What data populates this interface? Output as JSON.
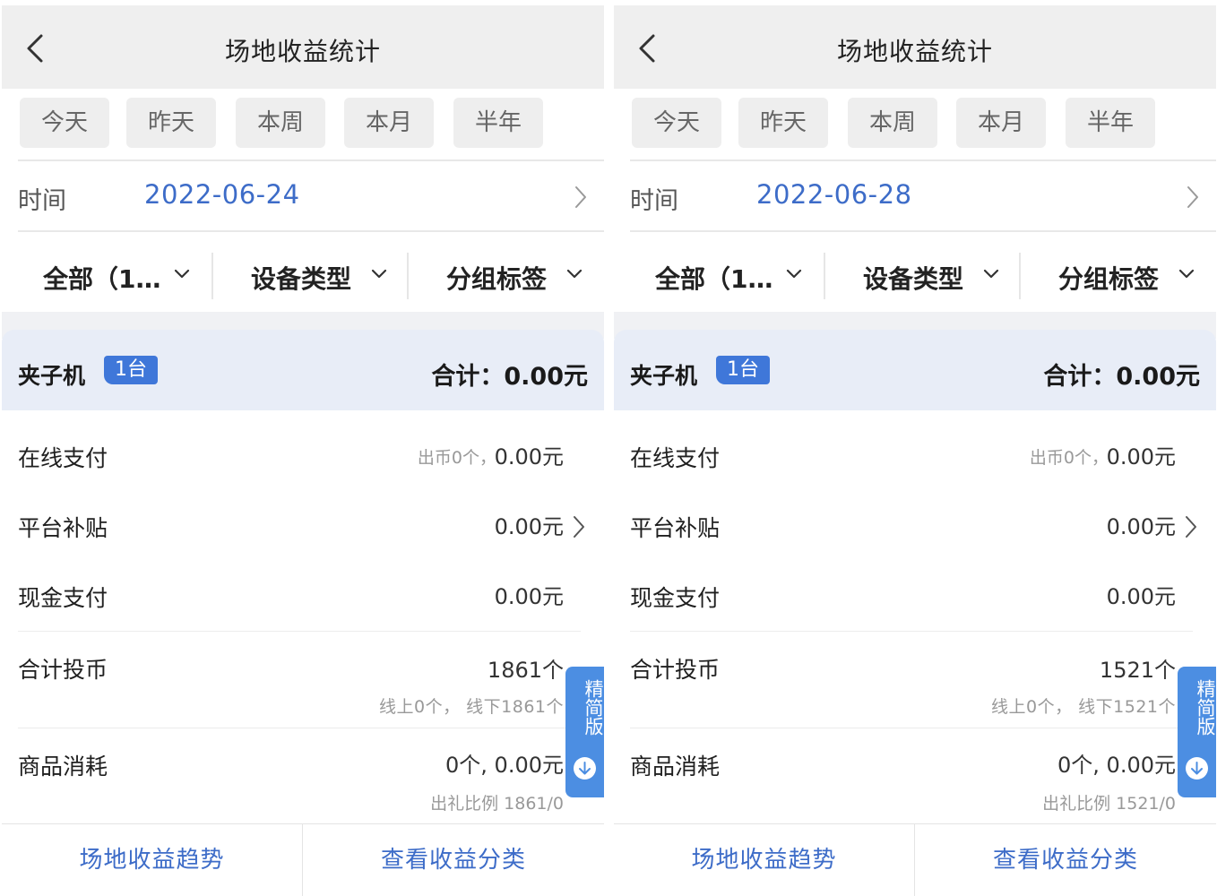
{
  "screens": [
    {
      "header": {
        "title": "场地收益统计",
        "back_icon": "chevron-left-icon"
      },
      "period_tabs": [
        "今天",
        "昨天",
        "本周",
        "本月",
        "半年"
      ],
      "time": {
        "label": "时间",
        "value": "2022-06-24"
      },
      "filters": [
        "全部（1…",
        "设备类型",
        "分组标签"
      ],
      "category": {
        "name": "夹子机",
        "count_badge": "1台",
        "total": "合计：0.00元"
      },
      "rows": {
        "online": {
          "label": "在线支付",
          "note": "出币0个，",
          "value": "0.00元"
        },
        "subsidy": {
          "label": "平台补贴",
          "value": "0.00元"
        },
        "cash": {
          "label": "现金支付",
          "value": "0.00元"
        },
        "coins": {
          "label": "合计投币",
          "value": "1861个",
          "sub": "线上0个， 线下1861个"
        },
        "goods": {
          "label": "商品消耗",
          "value": "0个, 0.00元",
          "sub": "出礼比例 1861/0"
        }
      },
      "side_button": {
        "label": "精简版",
        "icon": "arrow-down-circle-icon"
      },
      "bottom_buttons": [
        "场地收益趋势",
        "查看收益分类"
      ]
    },
    {
      "header": {
        "title": "场地收益统计",
        "back_icon": "chevron-left-icon"
      },
      "period_tabs": [
        "今天",
        "昨天",
        "本周",
        "本月",
        "半年"
      ],
      "time": {
        "label": "时间",
        "value": "2022-06-28"
      },
      "filters": [
        "全部（1…",
        "设备类型",
        "分组标签"
      ],
      "category": {
        "name": "夹子机",
        "count_badge": "1台",
        "total": "合计：0.00元"
      },
      "rows": {
        "online": {
          "label": "在线支付",
          "note": "出币0个，",
          "value": "0.00元"
        },
        "subsidy": {
          "label": "平台补贴",
          "value": "0.00元"
        },
        "cash": {
          "label": "现金支付",
          "value": "0.00元"
        },
        "coins": {
          "label": "合计投币",
          "value": "1521个",
          "sub": "线上0个， 线下1521个"
        },
        "goods": {
          "label": "商品消耗",
          "value": "0个, 0.00元",
          "sub": "出礼比例 1521/0"
        }
      },
      "side_button": {
        "label": "精简版",
        "icon": "arrow-down-circle-icon"
      },
      "bottom_buttons": [
        "场地收益趋势",
        "查看收益分类"
      ]
    }
  ],
  "colors": {
    "accent_blue": "#3d6cc8",
    "badge_blue": "#3f77d9",
    "side_button_blue": "#4c8ee2",
    "header_bg": "#efefef",
    "category_bg": "#e8edf7"
  }
}
